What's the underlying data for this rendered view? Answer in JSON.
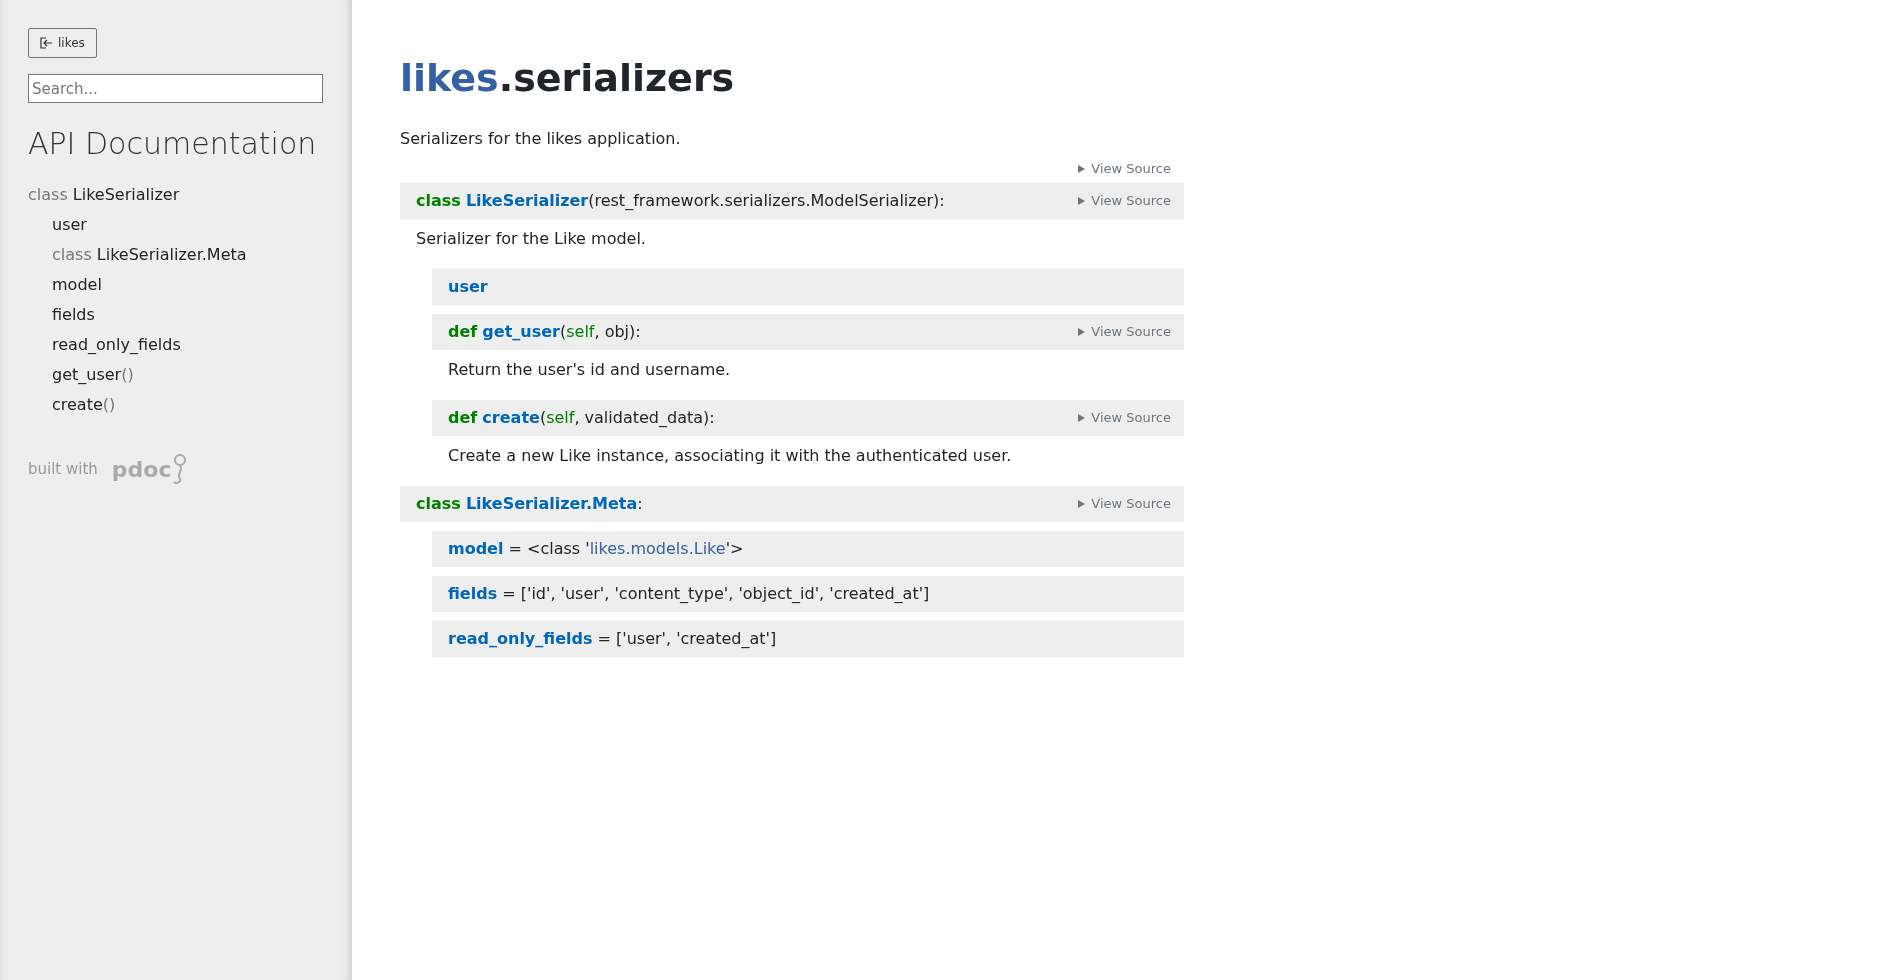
{
  "sidebar": {
    "module_button": {
      "label": "likes"
    },
    "search": {
      "placeholder": "Search..."
    },
    "heading": "API Documentation",
    "nav": [
      {
        "prefix": "class",
        "name": "LikeSerializer",
        "children": [
          {
            "name": "user"
          },
          {
            "prefix": "class",
            "name": "LikeSerializer.Meta"
          },
          {
            "name": "model"
          },
          {
            "name": "fields"
          },
          {
            "name": "read_only_fields"
          },
          {
            "name": "get_user",
            "suffix": "()"
          },
          {
            "name": "create",
            "suffix": "()"
          }
        ]
      }
    ],
    "footer": {
      "text": "built with",
      "logo": "pdoc"
    }
  },
  "main": {
    "title": {
      "package": "likes",
      "module": ".serializers"
    },
    "docstring": "Serializers for the likes application.",
    "view_source": "View Source",
    "members": [
      {
        "signature": [
          {
            "kind": "keyword",
            "text": "class"
          },
          {
            "kind": "name",
            "text": "LikeSerializer"
          },
          {
            "kind": "plain",
            "text": "(rest_framework.serializers.ModelSerializer):"
          }
        ],
        "view_source": "View Source",
        "docstring": "Serializer for the Like model.",
        "children": [
          {
            "signature": [
              {
                "kind": "name",
                "text": "user"
              }
            ]
          },
          {
            "signature": [
              {
                "kind": "keyword",
                "text": "def"
              },
              {
                "kind": "name",
                "text": "get_user"
              },
              {
                "kind": "plain",
                "text": "("
              },
              {
                "kind": "param",
                "text": "self"
              },
              {
                "kind": "plain",
                "text": ", obj):"
              }
            ],
            "view_source": "View Source",
            "docstring": "Return the user's id and username."
          },
          {
            "signature": [
              {
                "kind": "keyword",
                "text": "def"
              },
              {
                "kind": "name",
                "text": "create"
              },
              {
                "kind": "plain",
                "text": "("
              },
              {
                "kind": "param",
                "text": "self"
              },
              {
                "kind": "plain",
                "text": ", validated_data):"
              }
            ],
            "view_source": "View Source",
            "docstring": "Create a new Like instance, associating it with the authenticated user."
          }
        ]
      },
      {
        "signature": [
          {
            "kind": "keyword",
            "text": "class"
          },
          {
            "kind": "name",
            "text": "LikeSerializer.Meta"
          },
          {
            "kind": "plain",
            "text": ":"
          }
        ],
        "view_source": "View Source",
        "children": [
          {
            "signature": [
              {
                "kind": "name",
                "text": "model"
              },
              {
                "kind": "plain",
                "text": " = <class '"
              },
              {
                "kind": "link",
                "text": "likes.models.Like"
              },
              {
                "kind": "plain",
                "text": "'>"
              }
            ]
          },
          {
            "signature": [
              {
                "kind": "name",
                "text": "fields"
              },
              {
                "kind": "plain",
                "text": " = ['id', 'user', 'content_type', 'object_id', 'created_at']"
              }
            ]
          },
          {
            "signature": [
              {
                "kind": "name",
                "text": "read_only_fields"
              },
              {
                "kind": "plain",
                "text": " = ['user', 'created_at']"
              }
            ]
          }
        ]
      }
    ]
  }
}
